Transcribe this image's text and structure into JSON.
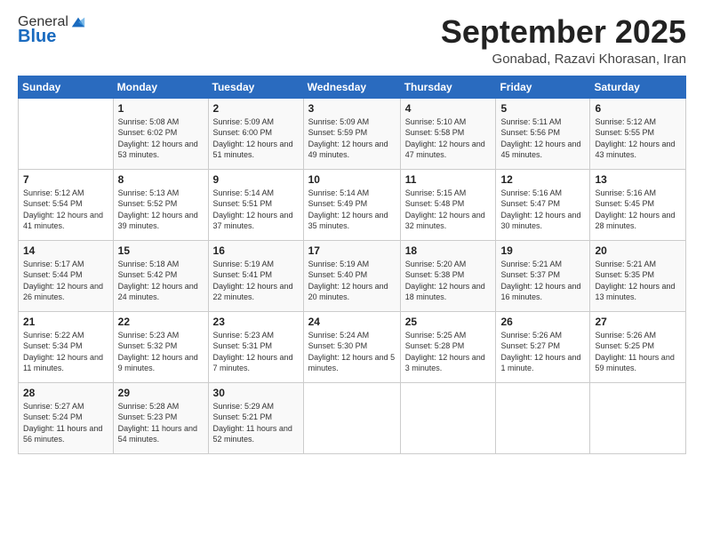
{
  "logo": {
    "general": "General",
    "blue": "Blue"
  },
  "header": {
    "month": "September 2025",
    "location": "Gonabad, Razavi Khorasan, Iran"
  },
  "weekdays": [
    "Sunday",
    "Monday",
    "Tuesday",
    "Wednesday",
    "Thursday",
    "Friday",
    "Saturday"
  ],
  "weeks": [
    [
      {
        "day": "",
        "sunrise": "",
        "sunset": "",
        "daylight": ""
      },
      {
        "day": "1",
        "sunrise": "Sunrise: 5:08 AM",
        "sunset": "Sunset: 6:02 PM",
        "daylight": "Daylight: 12 hours and 53 minutes."
      },
      {
        "day": "2",
        "sunrise": "Sunrise: 5:09 AM",
        "sunset": "Sunset: 6:00 PM",
        "daylight": "Daylight: 12 hours and 51 minutes."
      },
      {
        "day": "3",
        "sunrise": "Sunrise: 5:09 AM",
        "sunset": "Sunset: 5:59 PM",
        "daylight": "Daylight: 12 hours and 49 minutes."
      },
      {
        "day": "4",
        "sunrise": "Sunrise: 5:10 AM",
        "sunset": "Sunset: 5:58 PM",
        "daylight": "Daylight: 12 hours and 47 minutes."
      },
      {
        "day": "5",
        "sunrise": "Sunrise: 5:11 AM",
        "sunset": "Sunset: 5:56 PM",
        "daylight": "Daylight: 12 hours and 45 minutes."
      },
      {
        "day": "6",
        "sunrise": "Sunrise: 5:12 AM",
        "sunset": "Sunset: 5:55 PM",
        "daylight": "Daylight: 12 hours and 43 minutes."
      }
    ],
    [
      {
        "day": "7",
        "sunrise": "Sunrise: 5:12 AM",
        "sunset": "Sunset: 5:54 PM",
        "daylight": "Daylight: 12 hours and 41 minutes."
      },
      {
        "day": "8",
        "sunrise": "Sunrise: 5:13 AM",
        "sunset": "Sunset: 5:52 PM",
        "daylight": "Daylight: 12 hours and 39 minutes."
      },
      {
        "day": "9",
        "sunrise": "Sunrise: 5:14 AM",
        "sunset": "Sunset: 5:51 PM",
        "daylight": "Daylight: 12 hours and 37 minutes."
      },
      {
        "day": "10",
        "sunrise": "Sunrise: 5:14 AM",
        "sunset": "Sunset: 5:49 PM",
        "daylight": "Daylight: 12 hours and 35 minutes."
      },
      {
        "day": "11",
        "sunrise": "Sunrise: 5:15 AM",
        "sunset": "Sunset: 5:48 PM",
        "daylight": "Daylight: 12 hours and 32 minutes."
      },
      {
        "day": "12",
        "sunrise": "Sunrise: 5:16 AM",
        "sunset": "Sunset: 5:47 PM",
        "daylight": "Daylight: 12 hours and 30 minutes."
      },
      {
        "day": "13",
        "sunrise": "Sunrise: 5:16 AM",
        "sunset": "Sunset: 5:45 PM",
        "daylight": "Daylight: 12 hours and 28 minutes."
      }
    ],
    [
      {
        "day": "14",
        "sunrise": "Sunrise: 5:17 AM",
        "sunset": "Sunset: 5:44 PM",
        "daylight": "Daylight: 12 hours and 26 minutes."
      },
      {
        "day": "15",
        "sunrise": "Sunrise: 5:18 AM",
        "sunset": "Sunset: 5:42 PM",
        "daylight": "Daylight: 12 hours and 24 minutes."
      },
      {
        "day": "16",
        "sunrise": "Sunrise: 5:19 AM",
        "sunset": "Sunset: 5:41 PM",
        "daylight": "Daylight: 12 hours and 22 minutes."
      },
      {
        "day": "17",
        "sunrise": "Sunrise: 5:19 AM",
        "sunset": "Sunset: 5:40 PM",
        "daylight": "Daylight: 12 hours and 20 minutes."
      },
      {
        "day": "18",
        "sunrise": "Sunrise: 5:20 AM",
        "sunset": "Sunset: 5:38 PM",
        "daylight": "Daylight: 12 hours and 18 minutes."
      },
      {
        "day": "19",
        "sunrise": "Sunrise: 5:21 AM",
        "sunset": "Sunset: 5:37 PM",
        "daylight": "Daylight: 12 hours and 16 minutes."
      },
      {
        "day": "20",
        "sunrise": "Sunrise: 5:21 AM",
        "sunset": "Sunset: 5:35 PM",
        "daylight": "Daylight: 12 hours and 13 minutes."
      }
    ],
    [
      {
        "day": "21",
        "sunrise": "Sunrise: 5:22 AM",
        "sunset": "Sunset: 5:34 PM",
        "daylight": "Daylight: 12 hours and 11 minutes."
      },
      {
        "day": "22",
        "sunrise": "Sunrise: 5:23 AM",
        "sunset": "Sunset: 5:32 PM",
        "daylight": "Daylight: 12 hours and 9 minutes."
      },
      {
        "day": "23",
        "sunrise": "Sunrise: 5:23 AM",
        "sunset": "Sunset: 5:31 PM",
        "daylight": "Daylight: 12 hours and 7 minutes."
      },
      {
        "day": "24",
        "sunrise": "Sunrise: 5:24 AM",
        "sunset": "Sunset: 5:30 PM",
        "daylight": "Daylight: 12 hours and 5 minutes."
      },
      {
        "day": "25",
        "sunrise": "Sunrise: 5:25 AM",
        "sunset": "Sunset: 5:28 PM",
        "daylight": "Daylight: 12 hours and 3 minutes."
      },
      {
        "day": "26",
        "sunrise": "Sunrise: 5:26 AM",
        "sunset": "Sunset: 5:27 PM",
        "daylight": "Daylight: 12 hours and 1 minute."
      },
      {
        "day": "27",
        "sunrise": "Sunrise: 5:26 AM",
        "sunset": "Sunset: 5:25 PM",
        "daylight": "Daylight: 11 hours and 59 minutes."
      }
    ],
    [
      {
        "day": "28",
        "sunrise": "Sunrise: 5:27 AM",
        "sunset": "Sunset: 5:24 PM",
        "daylight": "Daylight: 11 hours and 56 minutes."
      },
      {
        "day": "29",
        "sunrise": "Sunrise: 5:28 AM",
        "sunset": "Sunset: 5:23 PM",
        "daylight": "Daylight: 11 hours and 54 minutes."
      },
      {
        "day": "30",
        "sunrise": "Sunrise: 5:29 AM",
        "sunset": "Sunset: 5:21 PM",
        "daylight": "Daylight: 11 hours and 52 minutes."
      },
      {
        "day": "",
        "sunrise": "",
        "sunset": "",
        "daylight": ""
      },
      {
        "day": "",
        "sunrise": "",
        "sunset": "",
        "daylight": ""
      },
      {
        "day": "",
        "sunrise": "",
        "sunset": "",
        "daylight": ""
      },
      {
        "day": "",
        "sunrise": "",
        "sunset": "",
        "daylight": ""
      }
    ]
  ]
}
